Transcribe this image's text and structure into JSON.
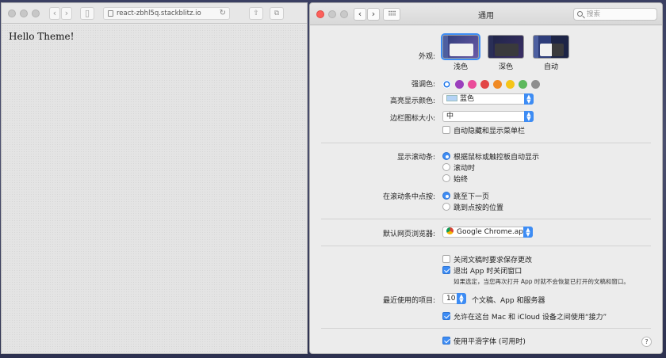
{
  "safari": {
    "address": "react-zbhl5q.stackblitz.io",
    "back_glyph": "‹",
    "forward_glyph": "›",
    "sidebar_glyph": "▯",
    "reload_glyph": "↻",
    "share_glyph": "⇧",
    "tabs_glyph": "⧉",
    "page_text": "Hello Theme!"
  },
  "prefs": {
    "title": "通用",
    "back_glyph": "‹",
    "forward_glyph": "›",
    "grid_glyph": "⠿⠿",
    "search_placeholder": "搜索",
    "appearance": {
      "label": "外观:",
      "options": [
        "浅色",
        "深色",
        "自动"
      ],
      "selected": "浅色"
    },
    "accent": {
      "label": "强调色:",
      "colors": [
        "#1a73e8",
        "#9b3fbd",
        "#ea4c9a",
        "#e24545",
        "#f08a24",
        "#f5c518",
        "#5cb85c",
        "#8e8e8e"
      ],
      "selected_index": 0
    },
    "highlight": {
      "label": "高亮显示颜色:",
      "value": "蓝色"
    },
    "sidebar_icon": {
      "label": "边栏图标大小:",
      "value": "中"
    },
    "auto_hide_menu": {
      "label": "自动隐藏和显示菜单栏",
      "checked": false
    },
    "scrollbars": {
      "label": "显示滚动条:",
      "options": [
        "根据鼠标或触控板自动显示",
        "滚动时",
        "始终"
      ],
      "selected_index": 0
    },
    "scroll_click": {
      "label": "在滚动条中点按:",
      "options": [
        "跳至下一页",
        "跳到点按的位置"
      ],
      "selected_index": 0
    },
    "browser": {
      "label": "默认网页浏览器:",
      "value": "Google Chrome.app"
    },
    "ask_keep_changes": {
      "label": "关闭文稿时要求保存更改",
      "checked": false
    },
    "close_windows": {
      "label": "退出 App 时关闭窗口",
      "checked": true,
      "note": "如果选定，当您再次打开 App 时就不会恢复已打开的文稿和窗口。"
    },
    "recent_items": {
      "label": "最近使用的项目:",
      "value": "10",
      "suffix": "个文稿、App 和服务器"
    },
    "handoff": {
      "label": "允许在这台 Mac 和 iCloud 设备之间使用“接力”",
      "checked": true
    },
    "font_smoothing": {
      "label": "使用平滑字体 (可用时)",
      "checked": true
    },
    "help_glyph": "?"
  }
}
